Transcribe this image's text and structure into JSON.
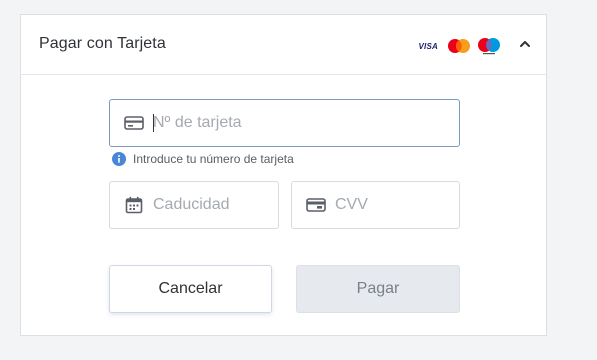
{
  "card": {
    "title": "Pagar con Tarjeta",
    "brands": {
      "visa_label": "VISA",
      "icons": [
        "visa-logo",
        "mastercard-logo",
        "maestro-logo"
      ]
    },
    "collapse_icon": "chevron-up-icon"
  },
  "form": {
    "card_number": {
      "placeholder": "Nº de tarjeta",
      "value": "",
      "icon": "credit-card-icon",
      "hint": "Introduce tu número de tarjeta",
      "hint_icon": "info-icon"
    },
    "expiry": {
      "placeholder": "Caducidad",
      "value": "",
      "icon": "calendar-icon"
    },
    "cvv": {
      "placeholder": "CVV",
      "value": "",
      "icon": "card-back-icon"
    }
  },
  "actions": {
    "cancel_label": "Cancelar",
    "pay_label": "Pagar"
  },
  "colors": {
    "page_bg": "#f3f4f6",
    "focus_border": "#7a9cc4",
    "info_icon": "#4a86d8",
    "mastercard_red": "#eb001b",
    "mastercard_orange": "#f79e1b",
    "maestro_blue": "#0099df",
    "disabled_button": "#e6e9ee"
  }
}
